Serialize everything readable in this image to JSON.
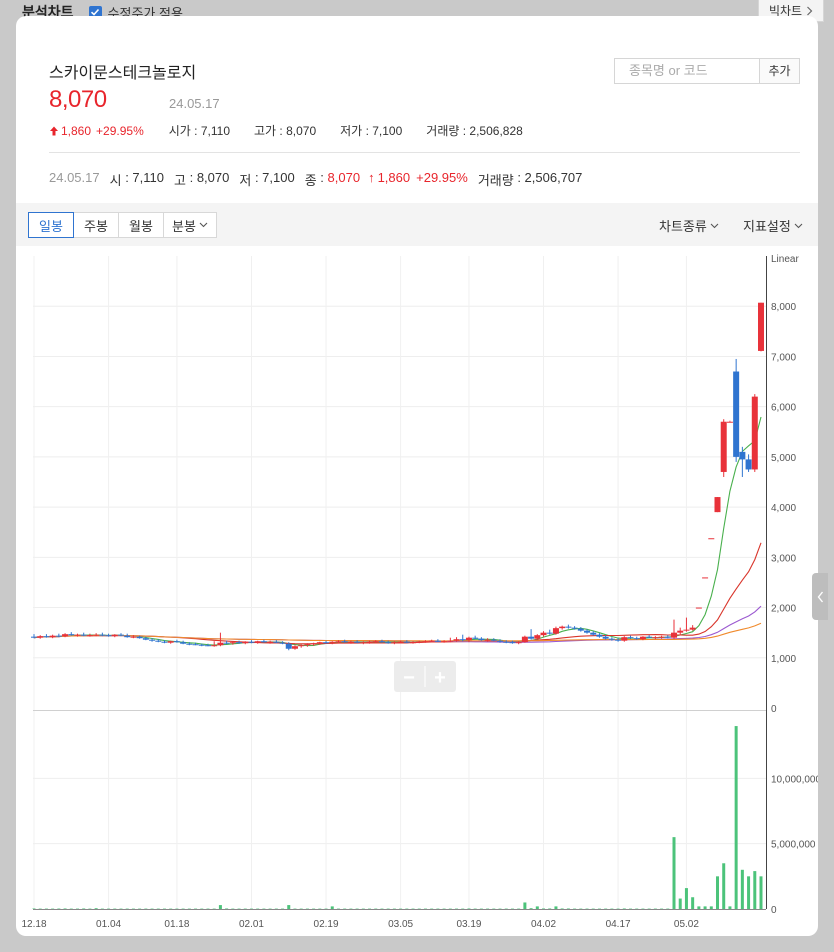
{
  "topbar": {
    "title": "분석차트",
    "adjust_label": "수정주가 적용",
    "big_chart_label": "빅차트"
  },
  "stock": {
    "name": "스카이문스테크놀로지",
    "price": "8,070",
    "date": "24.05.17"
  },
  "change": {
    "change": "1,860",
    "percent": "+29.95%"
  },
  "summary": {
    "open_label": "시가",
    "open": "7,110",
    "high_label": "고가",
    "high": "8,070",
    "low_label": "저가",
    "low": "7,100",
    "volume_label": "거래량",
    "volume": "2,506,828"
  },
  "search": {
    "placeholder": "종목명 or 코드",
    "add_label": "추가"
  },
  "ohlc": {
    "date": "24.05.17",
    "open_label": "시",
    "open": "7,110",
    "high_label": "고",
    "high": "8,070",
    "low_label": "저",
    "low": "7,100",
    "close_label": "종",
    "close": "8,070",
    "change": "1,860",
    "percent": "+29.95%",
    "volume_label": "거래량",
    "volume": "2,506,707"
  },
  "toolbar": {
    "tabs": [
      "일봉",
      "주봉",
      "월봉",
      "분봉"
    ],
    "chart_type_label": "차트종류",
    "indicator_label": "지표설정"
  },
  "zoom": {
    "minus": "−",
    "plus": "+"
  },
  "colors": {
    "up": "#e8323a",
    "down": "#2f74d0",
    "ma5": "#49b04d",
    "ma20": "#d9352b",
    "ma60": "#9b59d0",
    "ma120": "#f08a2c",
    "volume": "#4cc37a"
  },
  "chart_data": {
    "type": "candlestick",
    "price_axis": {
      "scale": "Linear",
      "range": [
        0,
        9000
      ],
      "ticks": [
        "0",
        "1,000",
        "2,000",
        "3,000",
        "4,000",
        "5,000",
        "6,000",
        "7,000",
        "8,000"
      ]
    },
    "volume_axis": {
      "range": [
        0,
        15000000
      ],
      "ticks": [
        "0",
        "5,000,000",
        "10,000,000"
      ]
    },
    "x_ticks": [
      "12.18",
      "01.04",
      "01.18",
      "02.01",
      "02.19",
      "03.05",
      "03.19",
      "04.02",
      "04.17",
      "05.02"
    ],
    "candles": [
      {
        "o": 1420,
        "h": 1470,
        "l": 1390,
        "c": 1400,
        "v": 40000
      },
      {
        "o": 1400,
        "h": 1450,
        "l": 1380,
        "c": 1430,
        "v": 30000
      },
      {
        "o": 1430,
        "h": 1470,
        "l": 1400,
        "c": 1410,
        "v": 30000
      },
      {
        "o": 1410,
        "h": 1460,
        "l": 1390,
        "c": 1440,
        "v": 30000
      },
      {
        "o": 1440,
        "h": 1480,
        "l": 1410,
        "c": 1430,
        "v": 35000
      },
      {
        "o": 1430,
        "h": 1490,
        "l": 1410,
        "c": 1470,
        "v": 40000
      },
      {
        "o": 1470,
        "h": 1510,
        "l": 1440,
        "c": 1450,
        "v": 30000
      },
      {
        "o": 1450,
        "h": 1480,
        "l": 1420,
        "c": 1460,
        "v": 30000
      },
      {
        "o": 1460,
        "h": 1500,
        "l": 1430,
        "c": 1440,
        "v": 40000
      },
      {
        "o": 1440,
        "h": 1480,
        "l": 1420,
        "c": 1450,
        "v": 30000
      },
      {
        "o": 1450,
        "h": 1490,
        "l": 1430,
        "c": 1460,
        "v": 60000
      },
      {
        "o": 1460,
        "h": 1500,
        "l": 1430,
        "c": 1450,
        "v": 30000
      },
      {
        "o": 1450,
        "h": 1480,
        "l": 1420,
        "c": 1430,
        "v": 30000
      },
      {
        "o": 1430,
        "h": 1470,
        "l": 1410,
        "c": 1460,
        "v": 30000
      },
      {
        "o": 1460,
        "h": 1490,
        "l": 1430,
        "c": 1440,
        "v": 30000
      },
      {
        "o": 1440,
        "h": 1480,
        "l": 1400,
        "c": 1410,
        "v": 30000
      },
      {
        "o": 1410,
        "h": 1450,
        "l": 1390,
        "c": 1420,
        "v": 30000
      },
      {
        "o": 1420,
        "h": 1440,
        "l": 1380,
        "c": 1390,
        "v": 30000
      },
      {
        "o": 1390,
        "h": 1420,
        "l": 1350,
        "c": 1360,
        "v": 30000
      },
      {
        "o": 1360,
        "h": 1390,
        "l": 1320,
        "c": 1340,
        "v": 30000
      },
      {
        "o": 1340,
        "h": 1370,
        "l": 1310,
        "c": 1320,
        "v": 30000
      },
      {
        "o": 1320,
        "h": 1350,
        "l": 1290,
        "c": 1300,
        "v": 30000
      },
      {
        "o": 1300,
        "h": 1340,
        "l": 1280,
        "c": 1330,
        "v": 30000
      },
      {
        "o": 1330,
        "h": 1360,
        "l": 1300,
        "c": 1310,
        "v": 30000
      },
      {
        "o": 1310,
        "h": 1340,
        "l": 1270,
        "c": 1280,
        "v": 30000
      },
      {
        "o": 1280,
        "h": 1310,
        "l": 1250,
        "c": 1270,
        "v": 30000
      },
      {
        "o": 1270,
        "h": 1300,
        "l": 1250,
        "c": 1260,
        "v": 30000
      },
      {
        "o": 1260,
        "h": 1280,
        "l": 1230,
        "c": 1250,
        "v": 30000
      },
      {
        "o": 1250,
        "h": 1280,
        "l": 1230,
        "c": 1240,
        "v": 30000
      },
      {
        "o": 1240,
        "h": 1330,
        "l": 1220,
        "c": 1250,
        "v": 30000
      },
      {
        "o": 1250,
        "h": 1500,
        "l": 1230,
        "c": 1300,
        "v": 300000
      },
      {
        "o": 1300,
        "h": 1340,
        "l": 1270,
        "c": 1290,
        "v": 40000
      },
      {
        "o": 1290,
        "h": 1330,
        "l": 1260,
        "c": 1310,
        "v": 30000
      },
      {
        "o": 1310,
        "h": 1340,
        "l": 1280,
        "c": 1290,
        "v": 30000
      },
      {
        "o": 1290,
        "h": 1330,
        "l": 1270,
        "c": 1320,
        "v": 30000
      },
      {
        "o": 1320,
        "h": 1350,
        "l": 1290,
        "c": 1300,
        "v": 30000
      },
      {
        "o": 1300,
        "h": 1340,
        "l": 1280,
        "c": 1330,
        "v": 30000
      },
      {
        "o": 1330,
        "h": 1360,
        "l": 1300,
        "c": 1310,
        "v": 30000
      },
      {
        "o": 1310,
        "h": 1340,
        "l": 1280,
        "c": 1320,
        "v": 30000
      },
      {
        "o": 1320,
        "h": 1350,
        "l": 1290,
        "c": 1300,
        "v": 30000
      },
      {
        "o": 1300,
        "h": 1330,
        "l": 1270,
        "c": 1280,
        "v": 30000
      },
      {
        "o": 1280,
        "h": 1310,
        "l": 1150,
        "c": 1180,
        "v": 300000
      },
      {
        "o": 1180,
        "h": 1250,
        "l": 1160,
        "c": 1230,
        "v": 30000
      },
      {
        "o": 1230,
        "h": 1270,
        "l": 1200,
        "c": 1250,
        "v": 30000
      },
      {
        "o": 1250,
        "h": 1290,
        "l": 1220,
        "c": 1270,
        "v": 30000
      },
      {
        "o": 1270,
        "h": 1300,
        "l": 1240,
        "c": 1290,
        "v": 30000
      },
      {
        "o": 1290,
        "h": 1320,
        "l": 1260,
        "c": 1310,
        "v": 30000
      },
      {
        "o": 1310,
        "h": 1340,
        "l": 1280,
        "c": 1300,
        "v": 30000
      },
      {
        "o": 1300,
        "h": 1330,
        "l": 1270,
        "c": 1320,
        "v": 200000
      },
      {
        "o": 1320,
        "h": 1350,
        "l": 1290,
        "c": 1330,
        "v": 30000
      },
      {
        "o": 1330,
        "h": 1360,
        "l": 1300,
        "c": 1310,
        "v": 30000
      },
      {
        "o": 1310,
        "h": 1340,
        "l": 1280,
        "c": 1320,
        "v": 30000
      },
      {
        "o": 1320,
        "h": 1350,
        "l": 1290,
        "c": 1300,
        "v": 30000
      },
      {
        "o": 1300,
        "h": 1330,
        "l": 1270,
        "c": 1310,
        "v": 30000
      },
      {
        "o": 1310,
        "h": 1340,
        "l": 1280,
        "c": 1320,
        "v": 30000
      },
      {
        "o": 1320,
        "h": 1350,
        "l": 1290,
        "c": 1330,
        "v": 30000
      },
      {
        "o": 1330,
        "h": 1360,
        "l": 1300,
        "c": 1310,
        "v": 30000
      },
      {
        "o": 1310,
        "h": 1340,
        "l": 1280,
        "c": 1300,
        "v": 30000
      },
      {
        "o": 1300,
        "h": 1330,
        "l": 1270,
        "c": 1310,
        "v": 30000
      },
      {
        "o": 1310,
        "h": 1340,
        "l": 1290,
        "c": 1320,
        "v": 30000
      },
      {
        "o": 1320,
        "h": 1350,
        "l": 1290,
        "c": 1300,
        "v": 30000
      },
      {
        "o": 1300,
        "h": 1330,
        "l": 1280,
        "c": 1310,
        "v": 30000
      },
      {
        "o": 1310,
        "h": 1340,
        "l": 1290,
        "c": 1320,
        "v": 30000
      },
      {
        "o": 1320,
        "h": 1350,
        "l": 1300,
        "c": 1330,
        "v": 30000
      },
      {
        "o": 1330,
        "h": 1360,
        "l": 1310,
        "c": 1340,
        "v": 30000
      },
      {
        "o": 1340,
        "h": 1370,
        "l": 1310,
        "c": 1320,
        "v": 30000
      },
      {
        "o": 1320,
        "h": 1350,
        "l": 1300,
        "c": 1330,
        "v": 30000
      },
      {
        "o": 1330,
        "h": 1400,
        "l": 1310,
        "c": 1340,
        "v": 30000
      },
      {
        "o": 1340,
        "h": 1410,
        "l": 1320,
        "c": 1370,
        "v": 30000
      },
      {
        "o": 1370,
        "h": 1460,
        "l": 1330,
        "c": 1350,
        "v": 30000
      },
      {
        "o": 1350,
        "h": 1420,
        "l": 1310,
        "c": 1400,
        "v": 40000
      },
      {
        "o": 1400,
        "h": 1440,
        "l": 1370,
        "c": 1380,
        "v": 30000
      },
      {
        "o": 1380,
        "h": 1410,
        "l": 1340,
        "c": 1350,
        "v": 30000
      },
      {
        "o": 1350,
        "h": 1390,
        "l": 1320,
        "c": 1360,
        "v": 30000
      },
      {
        "o": 1360,
        "h": 1390,
        "l": 1330,
        "c": 1340,
        "v": 30000
      },
      {
        "o": 1340,
        "h": 1370,
        "l": 1300,
        "c": 1320,
        "v": 30000
      },
      {
        "o": 1320,
        "h": 1350,
        "l": 1290,
        "c": 1310,
        "v": 30000
      },
      {
        "o": 1310,
        "h": 1340,
        "l": 1280,
        "c": 1300,
        "v": 30000
      },
      {
        "o": 1300,
        "h": 1330,
        "l": 1270,
        "c": 1310,
        "v": 30000
      },
      {
        "o": 1310,
        "h": 1440,
        "l": 1300,
        "c": 1420,
        "v": 500000
      },
      {
        "o": 1420,
        "h": 1570,
        "l": 1360,
        "c": 1380,
        "v": 60000
      },
      {
        "o": 1380,
        "h": 1470,
        "l": 1360,
        "c": 1450,
        "v": 200000
      },
      {
        "o": 1450,
        "h": 1530,
        "l": 1420,
        "c": 1500,
        "v": 40000
      },
      {
        "o": 1500,
        "h": 1560,
        "l": 1460,
        "c": 1480,
        "v": 40000
      },
      {
        "o": 1480,
        "h": 1620,
        "l": 1460,
        "c": 1590,
        "v": 200000
      },
      {
        "o": 1590,
        "h": 1640,
        "l": 1560,
        "c": 1620,
        "v": 40000
      },
      {
        "o": 1620,
        "h": 1660,
        "l": 1580,
        "c": 1600,
        "v": 40000
      },
      {
        "o": 1600,
        "h": 1630,
        "l": 1560,
        "c": 1580,
        "v": 30000
      },
      {
        "o": 1580,
        "h": 1610,
        "l": 1520,
        "c": 1540,
        "v": 30000
      },
      {
        "o": 1540,
        "h": 1570,
        "l": 1480,
        "c": 1500,
        "v": 30000
      },
      {
        "o": 1500,
        "h": 1530,
        "l": 1440,
        "c": 1460,
        "v": 30000
      },
      {
        "o": 1460,
        "h": 1490,
        "l": 1400,
        "c": 1420,
        "v": 30000
      },
      {
        "o": 1420,
        "h": 1450,
        "l": 1360,
        "c": 1380,
        "v": 30000
      },
      {
        "o": 1380,
        "h": 1410,
        "l": 1340,
        "c": 1360,
        "v": 30000
      },
      {
        "o": 1360,
        "h": 1390,
        "l": 1320,
        "c": 1340,
        "v": 30000
      },
      {
        "o": 1340,
        "h": 1430,
        "l": 1320,
        "c": 1410,
        "v": 40000
      },
      {
        "o": 1410,
        "h": 1440,
        "l": 1380,
        "c": 1390,
        "v": 30000
      },
      {
        "o": 1390,
        "h": 1420,
        "l": 1360,
        "c": 1370,
        "v": 30000
      },
      {
        "o": 1370,
        "h": 1430,
        "l": 1350,
        "c": 1420,
        "v": 30000
      },
      {
        "o": 1420,
        "h": 1450,
        "l": 1390,
        "c": 1400,
        "v": 30000
      },
      {
        "o": 1400,
        "h": 1430,
        "l": 1370,
        "c": 1410,
        "v": 30000
      },
      {
        "o": 1410,
        "h": 1440,
        "l": 1380,
        "c": 1420,
        "v": 30000
      },
      {
        "o": 1420,
        "h": 1450,
        "l": 1390,
        "c": 1400,
        "v": 30000
      },
      {
        "o": 1400,
        "h": 1760,
        "l": 1380,
        "c": 1500,
        "v": 5500000
      },
      {
        "o": 1500,
        "h": 1600,
        "l": 1450,
        "c": 1540,
        "v": 800000
      },
      {
        "o": 1540,
        "h": 1800,
        "l": 1520,
        "c": 1560,
        "v": 1600000
      },
      {
        "o": 1560,
        "h": 1650,
        "l": 1540,
        "c": 1600,
        "v": 900000
      },
      {
        "o": 2000,
        "h": 2000,
        "l": 2000,
        "c": 2000,
        "v": 200000
      },
      {
        "o": 2600,
        "h": 2600,
        "l": 2600,
        "c": 2600,
        "v": 200000
      },
      {
        "o": 3380,
        "h": 3380,
        "l": 3380,
        "c": 3380,
        "v": 200000
      },
      {
        "o": 3900,
        "h": 4200,
        "l": 3900,
        "c": 4200,
        "v": 2500000
      },
      {
        "o": 4700,
        "h": 5750,
        "l": 4600,
        "c": 5700,
        "v": 3500000
      },
      {
        "o": 5700,
        "h": 5720,
        "l": 5700,
        "c": 5700,
        "v": 200000
      },
      {
        "o": 6700,
        "h": 6950,
        "l": 4900,
        "c": 5000,
        "v": 14000000
      },
      {
        "o": 5100,
        "h": 5200,
        "l": 4600,
        "c": 4950,
        "v": 3000000
      },
      {
        "o": 4950,
        "h": 5050,
        "l": 4700,
        "c": 4750,
        "v": 2500000
      },
      {
        "o": 4750,
        "h": 6250,
        "l": 4700,
        "c": 6200,
        "v": 2900000
      },
      {
        "o": 7110,
        "h": 8070,
        "l": 7100,
        "c": 8070,
        "v": 2500000
      }
    ],
    "moving_averages": [
      {
        "name": "MA5",
        "color": "#49b04d",
        "period": 5
      },
      {
        "name": "MA20",
        "color": "#d9352b",
        "period": 20
      },
      {
        "name": "MA60",
        "color": "#9b59d0",
        "period": 60
      },
      {
        "name": "MA120",
        "color": "#f08a2c",
        "period": 120
      }
    ]
  }
}
